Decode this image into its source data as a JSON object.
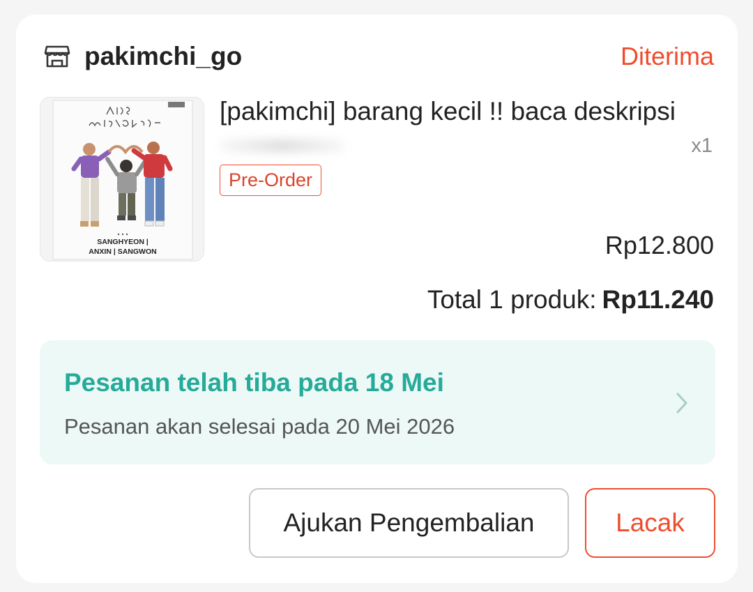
{
  "store": {
    "icon": "store-icon",
    "name": "pakimchi_go",
    "status": "Diterima"
  },
  "product": {
    "title": "[pakimchi] barang kecil !! baca deskripsi",
    "quantity": "x1",
    "badge": "Pre-Order",
    "price": "Rp12.800",
    "image_caption_line1": "SANGHYEON | ",
    "image_caption_line2": "ANXIN | SANGWON"
  },
  "total": {
    "label": "Total 1 produk:",
    "amount": "Rp11.240"
  },
  "delivery": {
    "title": "Pesanan telah tiba pada 18 Mei",
    "subtitle": "Pesanan akan selesai pada 20 Mei 2026"
  },
  "actions": {
    "return_label": "Ajukan Pengembalian",
    "track_label": "Lacak"
  },
  "colors": {
    "accent": "#ee4d2d",
    "delivery_green": "#26aa99",
    "delivery_bg": "#ecf9f6"
  }
}
